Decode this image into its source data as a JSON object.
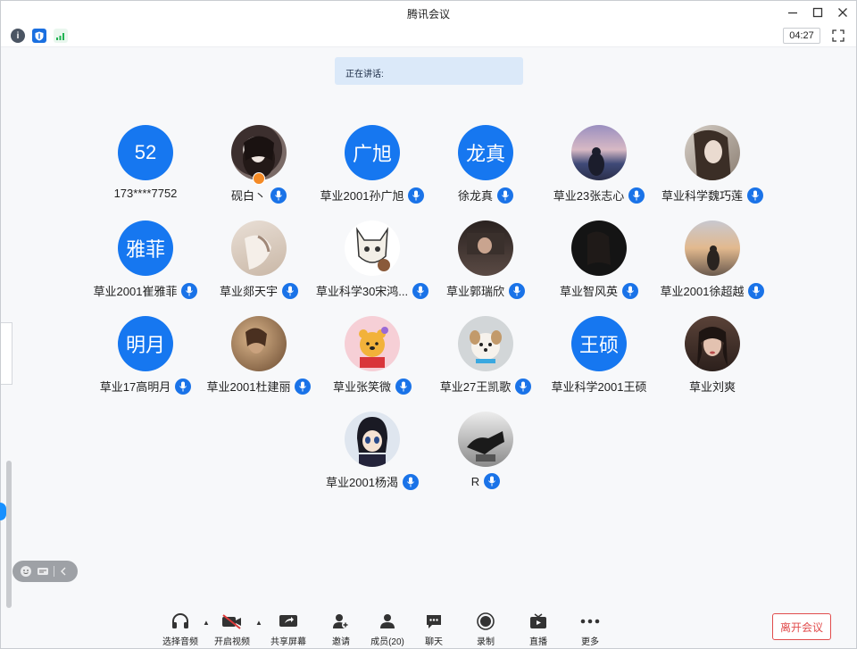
{
  "window": {
    "title": "腾讯会议"
  },
  "top_toolbar": {
    "timer": "04:27"
  },
  "speaking": {
    "label": "正在讲话:"
  },
  "participants": [
    {
      "name": "173****7752",
      "avatar_text": "52",
      "mic": false
    },
    {
      "name": "砚白丶",
      "avatar_text": "",
      "mic": true,
      "host": true
    },
    {
      "name": "草业2001孙广旭",
      "avatar_text": "广旭",
      "mic": true
    },
    {
      "name": "徐龙真",
      "avatar_text": "龙真",
      "mic": true
    },
    {
      "name": "草业23张志心",
      "avatar_text": "",
      "mic": true
    },
    {
      "name": "草业科学魏巧莲",
      "avatar_text": "",
      "mic": true
    },
    {
      "name": "草业2001崔雅菲",
      "avatar_text": "雅菲",
      "mic": true
    },
    {
      "name": "草业郯天宇",
      "avatar_text": "",
      "mic": true
    },
    {
      "name": "草业科学30宋鸿...",
      "avatar_text": "",
      "mic": true
    },
    {
      "name": "草业郭瑞欣",
      "avatar_text": "",
      "mic": true
    },
    {
      "name": "草业智风英",
      "avatar_text": "",
      "mic": true
    },
    {
      "name": "草业2001徐超越",
      "avatar_text": "",
      "mic": true
    },
    {
      "name": "草业17高明月",
      "avatar_text": "明月",
      "mic": true
    },
    {
      "name": "草业2001杜建丽",
      "avatar_text": "",
      "mic": true
    },
    {
      "name": "草业张笑微",
      "avatar_text": "",
      "mic": true
    },
    {
      "name": "草业27王凯歌",
      "avatar_text": "",
      "mic": true
    },
    {
      "name": "草业科学2001王硕",
      "avatar_text": "王硕",
      "mic": false
    },
    {
      "name": "草业刘爽",
      "avatar_text": "",
      "mic": false
    },
    {
      "name": "草业2001杨渴",
      "avatar_text": "",
      "mic": true
    },
    {
      "name": "R",
      "avatar_text": "",
      "mic": true
    }
  ],
  "bottom": {
    "audio": "选择音频",
    "video": "开启视频",
    "share": "共享屏幕",
    "invite": "邀请",
    "members": "成员(20)",
    "chat": "聊天",
    "record": "录制",
    "live": "直播",
    "more": "更多",
    "leave": "离开会议"
  },
  "colors": {
    "accent": "#1677f0",
    "leave": "#e14c4c"
  }
}
